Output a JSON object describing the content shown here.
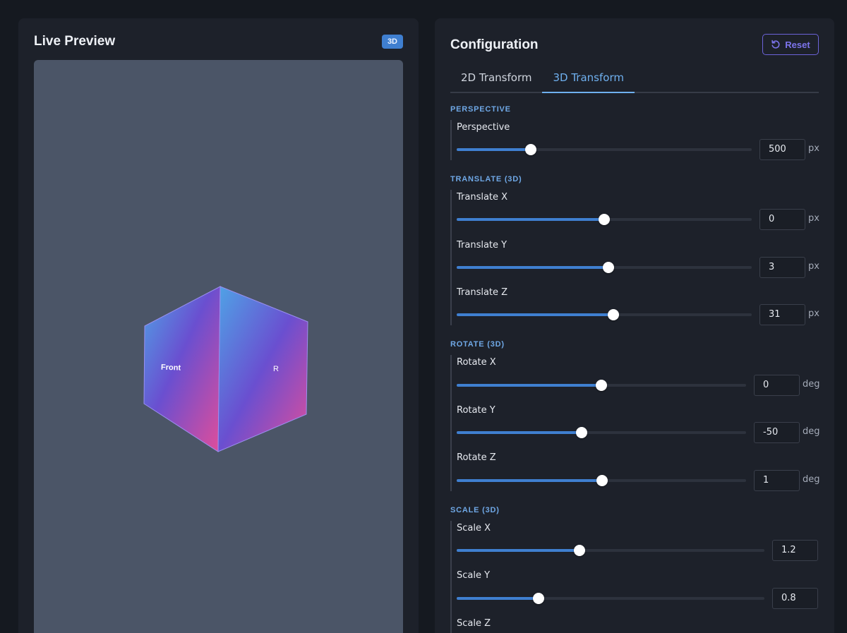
{
  "preview": {
    "title": "Live Preview",
    "badge": "3D",
    "front_face_label": "Front",
    "right_face_label": "R"
  },
  "config": {
    "title": "Configuration",
    "reset_label": "Reset",
    "tabs": [
      {
        "label": "2D Transform",
        "active": false
      },
      {
        "label": "3D Transform",
        "active": true
      }
    ],
    "sections": {
      "perspective": {
        "title": "PERSPECTIVE",
        "controls": [
          {
            "label": "Perspective",
            "value": "500",
            "unit": "px",
            "fraction": 0.25
          }
        ]
      },
      "translate": {
        "title": "TRANSLATE (3D)",
        "controls": [
          {
            "label": "Translate X",
            "value": "0",
            "unit": "px",
            "fraction": 0.5
          },
          {
            "label": "Translate Y",
            "value": "3",
            "unit": "px",
            "fraction": 0.515
          },
          {
            "label": "Translate Z",
            "value": "31",
            "unit": "px",
            "fraction": 0.531
          }
        ]
      },
      "rotate": {
        "title": "ROTATE (3D)",
        "controls": [
          {
            "label": "Rotate X",
            "value": "0",
            "unit": "deg",
            "fraction": 0.5
          },
          {
            "label": "Rotate Y",
            "value": "-50",
            "unit": "deg",
            "fraction": 0.431
          },
          {
            "label": "Rotate Z",
            "value": "1",
            "unit": "deg",
            "fraction": 0.502
          }
        ]
      },
      "scale": {
        "title": "SCALE (3D)",
        "controls": [
          {
            "label": "Scale X",
            "value": "1.2",
            "unit": "",
            "fraction": 0.4
          },
          {
            "label": "Scale Y",
            "value": "0.8",
            "unit": "",
            "fraction": 0.267
          },
          {
            "label": "Scale Z",
            "value": "",
            "unit": "",
            "fraction": null
          }
        ]
      }
    }
  },
  "colors": {
    "accent": "#3f7fd0",
    "tab_active": "#6fb0ef",
    "reset": "#7c74ec",
    "cube_gradient": [
      "#4fa3e6",
      "#6a4fd0",
      "#e04d9a"
    ]
  }
}
